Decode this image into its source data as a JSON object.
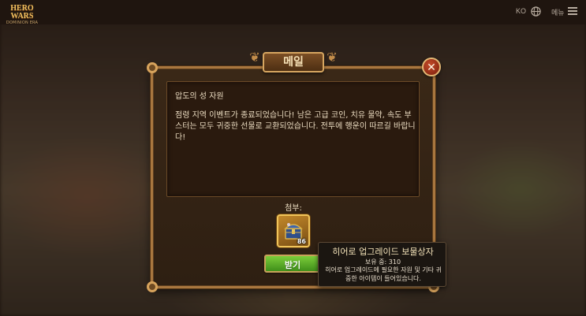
{
  "top_bar": {
    "logo_main": "HERO WARS",
    "logo_sub": "DOMINION ERA",
    "language": "KO",
    "menu_label": "메뉴"
  },
  "dialog": {
    "title": "메일",
    "sender": "압도의 성 자원",
    "body": "점령 지역 이벤트가 종료되었습니다! 남은 고급 코인, 치유 물약, 속도 부스터는 모두 귀중한 선물로 교환되었습니다. 전투에 행운이 따르길 바랍니다!",
    "attachment_label": "첨부:",
    "attachment": {
      "count": "86",
      "icon": "treasure-chest-icon"
    },
    "receive_button": "받기"
  },
  "tooltip": {
    "title": "히어로 업그레이드 보물상자",
    "owned": "보유 중: 310",
    "description": "히어로 업그레이드에 필요한 자원 및 기타 귀중한 아이템이 들어있습니다."
  },
  "colors": {
    "frame_gold": "#a9773f",
    "button_green": "#5aaf28",
    "close_red": "#a83418"
  }
}
